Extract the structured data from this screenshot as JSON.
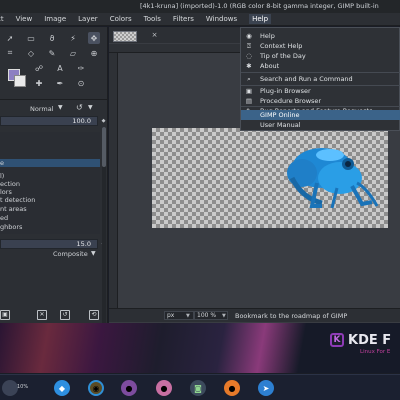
{
  "window": {
    "title": "[4k1-kruna] (imported)-1.0 (RGB color 8-bit gamma integer, GIMP built-in"
  },
  "menubar": {
    "items": [
      "ct",
      "View",
      "Image",
      "Layer",
      "Colors",
      "Tools",
      "Filters",
      "Windows",
      "Help"
    ]
  },
  "toolbox": {
    "tools": [
      "pointer-icon",
      "rect-select-icon",
      "lasso-icon",
      "fuzzy-select-icon",
      "move-icon",
      "crop-icon",
      "transform-icon",
      "brush-icon",
      "eraser-icon",
      "clone-icon",
      "heal-icon",
      "smudge-icon",
      "text-icon",
      "paths-icon",
      "color-picker-icon"
    ],
    "fg_color": "#8d7fc2",
    "bg_color": "#e9e9e9"
  },
  "tool_options": {
    "mode": "Normal",
    "opacity": "100.0",
    "size": "15.0",
    "composite": "Composite"
  },
  "select_list": {
    "items": [
      "",
      "",
      "e",
      "l)",
      "ection",
      "lors",
      "t detection",
      "nt areas",
      "ed",
      "ghbors"
    ],
    "selected_index": 2
  },
  "canvas": {
    "tab_close": "×"
  },
  "statusbar": {
    "unit": "px",
    "zoom": "100 %",
    "message": "Bookmark to the roadmap of GIMP"
  },
  "help_menu": {
    "items": [
      {
        "icon": "help-icon",
        "glyph": "◉",
        "label": "Help"
      },
      {
        "icon": "context-help-icon",
        "glyph": "⍰",
        "label": "Context Help"
      },
      {
        "icon": "tip-icon",
        "glyph": "◌",
        "label": "Tip of the Day"
      },
      {
        "icon": "gimp-icon",
        "glyph": "✱",
        "label": "About"
      },
      {
        "icon": "search-icon",
        "glyph": "⌕",
        "label": "Search and Run a Command"
      },
      {
        "icon": "plugin-icon",
        "glyph": "▣",
        "label": "Plug-in Browser"
      },
      {
        "icon": "procedure-icon",
        "glyph": "▤",
        "label": "Procedure Browser"
      },
      {
        "icon": "bug-icon",
        "glyph": "✎",
        "label": "Bug Reports and Feature Requests"
      },
      {
        "icon": "",
        "glyph": "",
        "label": "GIMP Online"
      },
      {
        "icon": "",
        "glyph": "",
        "label": "User Manual"
      }
    ],
    "highlighted": "GIMP Online"
  },
  "desktop": {
    "logo_title": "KDE F",
    "logo_subtitle": "Linux For E"
  },
  "taskbar": {
    "badge": "10%"
  }
}
